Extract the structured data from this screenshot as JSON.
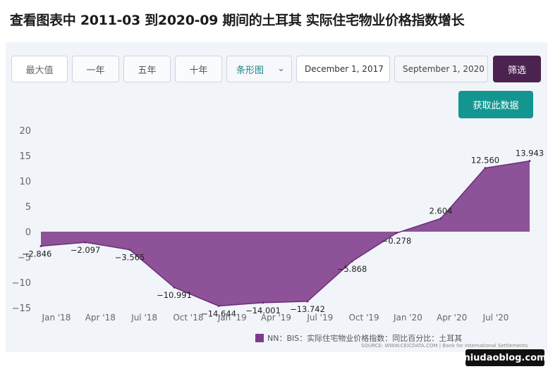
{
  "title": "查看图表中 2011-03 到2020-09 期间的土耳其 实际住宅物业价格指数增长",
  "controls": {
    "range_buttons": [
      "最大值",
      "一年",
      "五年",
      "十年"
    ],
    "chart_type": "条形图",
    "start_date": "December 1, 2017",
    "end_date": "September 1, 2020",
    "filter_label": "筛选",
    "get_data_label": "获取此数据"
  },
  "legend_label": "NN：BIS：实际住宅物业价格指数：同比百分比：土耳其",
  "source": "SOURCE: WWW.CEICDATA.COM | Bank for International Settlements",
  "watermark": "niudaoblog.com",
  "colors": {
    "series": "#7e3b8a",
    "filter_button": "#4b2250",
    "get_data_button": "#149690"
  },
  "chart_data": {
    "type": "area",
    "x": [
      "2017-12",
      "2018-03",
      "2018-06",
      "2018-09",
      "2018-12",
      "2019-03",
      "2019-06",
      "2019-09",
      "2019-12",
      "2020-03",
      "2020-06",
      "2020-09"
    ],
    "values": [
      -2.846,
      -2.097,
      -3.565,
      -10.991,
      -14.644,
      -14.001,
      -13.742,
      -5.868,
      -0.278,
      2.604,
      12.56,
      13.943
    ],
    "data_labels": [
      "-2.846",
      "-2.097",
      "-3.565",
      "-10.991",
      "-14.644",
      "-14.001",
      "-13.742",
      "-5.868",
      "-0.278",
      "2.604",
      "12.560",
      "13.943"
    ],
    "x_ticks": [
      "Jan '18",
      "Apr '18",
      "Jul '18",
      "Oct '18",
      "Jan '19",
      "Apr '19",
      "Jul '19",
      "Oct '19",
      "Jan '20",
      "Apr '20",
      "Jul '20"
    ],
    "y_ticks": [
      "20",
      "15",
      "10",
      "5",
      "0",
      "-5",
      "-10",
      "-15"
    ],
    "ylim": [
      -15,
      20
    ],
    "grid": false
  }
}
